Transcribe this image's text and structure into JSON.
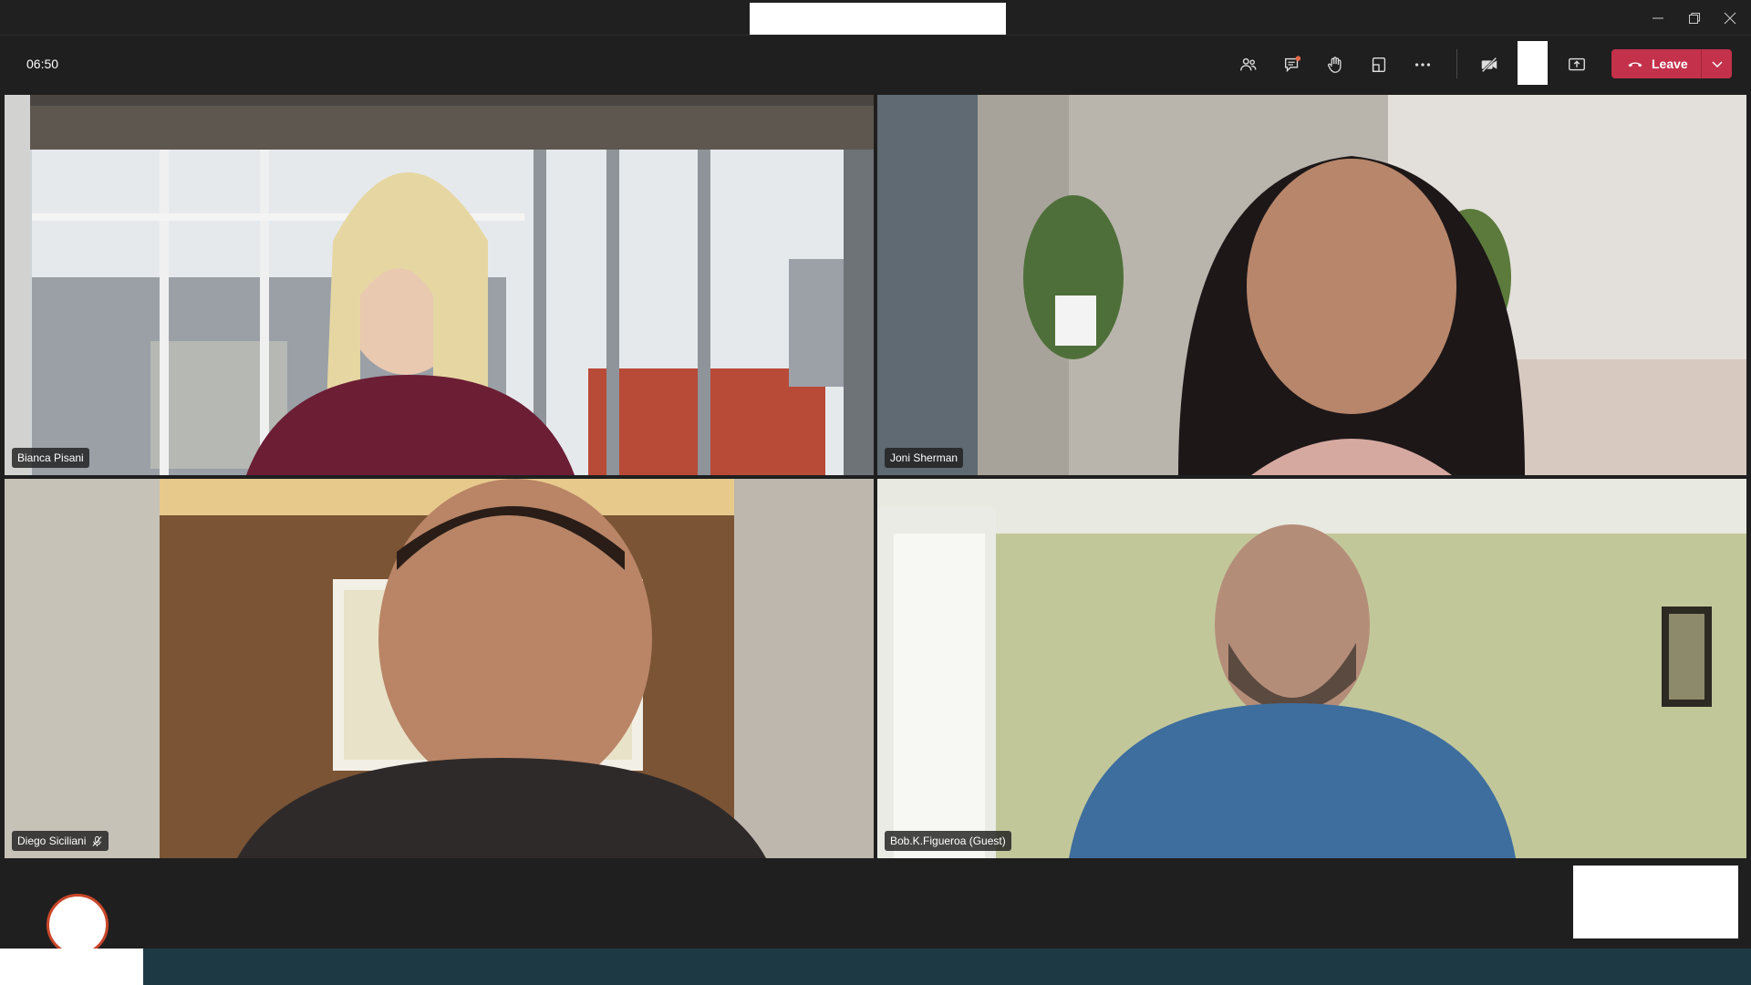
{
  "window": {
    "controls": {
      "minimize_icon": "minimize-icon",
      "restore_icon": "restore-icon",
      "close_icon": "close-icon"
    }
  },
  "meeting": {
    "timer": "06:50",
    "controls": [
      {
        "name": "participants",
        "icon": "people-icon"
      },
      {
        "name": "chat",
        "icon": "chat-icon",
        "has_notification": true
      },
      {
        "name": "raise-hand",
        "icon": "hand-icon"
      },
      {
        "name": "rooms",
        "icon": "rooms-icon"
      },
      {
        "name": "more-actions",
        "icon": "more-icon"
      },
      {
        "name": "camera",
        "icon": "camera-off-icon"
      },
      {
        "name": "share",
        "icon": "share-screen-icon"
      }
    ],
    "leave": {
      "label": "Leave",
      "color": "#c4314b"
    }
  },
  "participants": [
    {
      "name": "Bianca Pisani",
      "muted": false
    },
    {
      "name": "Joni Sherman",
      "muted": false
    },
    {
      "name": "Diego Siciliani",
      "muted": true
    },
    {
      "name": "Bob.K.Figueroa (Guest)",
      "muted": false
    }
  ],
  "colors": {
    "background": "#1f1f1f",
    "leave_red": "#c4314b",
    "notification": "#e86a4b",
    "avatar_ring": "#c8472a",
    "taskbar": "#1d3a44"
  }
}
